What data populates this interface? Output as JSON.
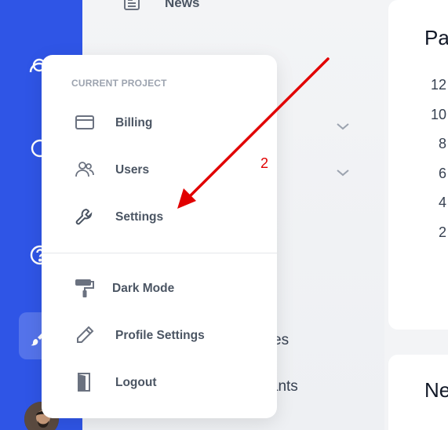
{
  "background": {
    "nav_item": "News",
    "fragment_1": "es",
    "fragment_2": "urants",
    "card_top_title": "Pa",
    "card_bottom_title": "Ne",
    "y_ticks": [
      "12",
      "10",
      "8",
      "6",
      "4",
      "2"
    ]
  },
  "menu": {
    "heading": "CURRENT PROJECT",
    "items": [
      {
        "label": "Billing",
        "icon": "card-icon"
      },
      {
        "label": "Users",
        "icon": "users-icon"
      },
      {
        "label": "Settings",
        "icon": "wrench-icon"
      },
      {
        "label": "Dark Mode",
        "icon": "paint-roller-icon"
      },
      {
        "label": "Profile Settings",
        "icon": "pencil-icon"
      },
      {
        "label": "Logout",
        "icon": "door-icon"
      }
    ]
  },
  "annotation": {
    "number": "2",
    "color": "#e10000"
  },
  "colors": {
    "rail": "#2f55e6",
    "menu_text": "#4b5563",
    "heading": "#9ca3af"
  }
}
